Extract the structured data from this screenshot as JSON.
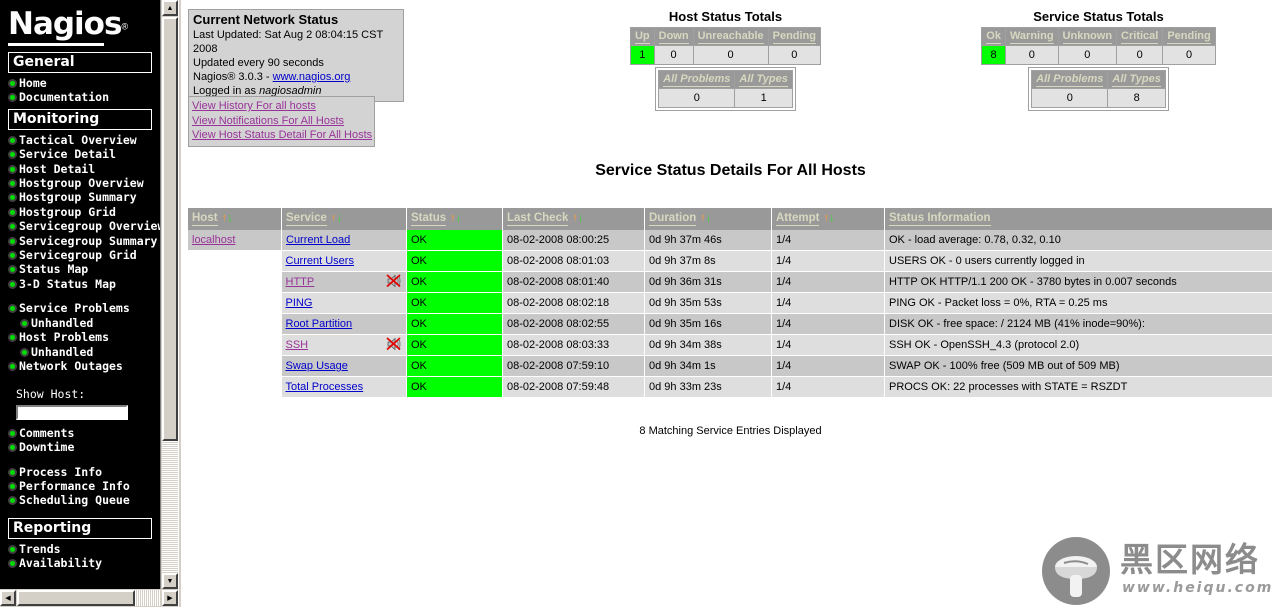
{
  "sidebar": {
    "logo": {
      "text": "Nagios",
      "registered": "®"
    },
    "sections": [
      {
        "title": "General",
        "items": [
          {
            "label": "Home",
            "sub": false
          },
          {
            "label": "Documentation",
            "sub": false
          }
        ]
      },
      {
        "title": "Monitoring",
        "items": [
          {
            "label": "Tactical Overview",
            "sub": false
          },
          {
            "label": "Service Detail",
            "sub": false
          },
          {
            "label": "Host Detail",
            "sub": false
          },
          {
            "label": "Hostgroup Overview",
            "sub": false
          },
          {
            "label": "Hostgroup Summary",
            "sub": false
          },
          {
            "label": "Hostgroup Grid",
            "sub": false
          },
          {
            "label": "Servicegroup Overview",
            "sub": false
          },
          {
            "label": "Servicegroup Summary",
            "sub": false
          },
          {
            "label": "Servicegroup Grid",
            "sub": false
          },
          {
            "label": "Status Map",
            "sub": false
          },
          {
            "label": "3-D Status Map",
            "sub": false
          },
          {
            "label": "",
            "gap": true
          },
          {
            "label": "Service Problems",
            "sub": false
          },
          {
            "label": "Unhandled",
            "sub": true
          },
          {
            "label": "Host Problems",
            "sub": false
          },
          {
            "label": "Unhandled",
            "sub": true
          },
          {
            "label": "Network Outages",
            "sub": false
          }
        ]
      }
    ],
    "show_host": {
      "label": "Show Host:",
      "value": "",
      "placeholder": ""
    },
    "post_items": [
      {
        "label": "Comments",
        "sub": false
      },
      {
        "label": "Downtime",
        "sub": false
      },
      {
        "label": "",
        "gap": true
      },
      {
        "label": "Process Info",
        "sub": false
      },
      {
        "label": "Performance Info",
        "sub": false
      },
      {
        "label": "Scheduling Queue",
        "sub": false
      }
    ],
    "reporting": {
      "title": "Reporting",
      "items": [
        {
          "label": "Trends",
          "sub": false
        },
        {
          "label": "Availability",
          "sub": false
        }
      ]
    },
    "scrollbar": {
      "up_arrow": "▲",
      "down_arrow": "▼",
      "left_arrow": "◀",
      "right_arrow": "▶"
    }
  },
  "network_status": {
    "heading": "Current Network Status",
    "last_updated": "Last Updated: Sat Aug 2 08:04:15 CST 2008",
    "update_interval": "Updated every 90 seconds",
    "version_prefix": "Nagios® 3.0.3 - ",
    "version_link": "www.nagios.org",
    "logged_in_prefix": "Logged in as ",
    "logged_in_user": "nagiosadmin"
  },
  "quick_links": [
    {
      "label": "View History For all hosts"
    },
    {
      "label": "View Notifications For All Hosts"
    },
    {
      "label": "View Host Status Detail For All Hosts"
    }
  ],
  "host_totals": {
    "title": "Host Status Totals",
    "headers": [
      "Up",
      "Down",
      "Unreachable",
      "Pending"
    ],
    "values": [
      "1",
      "0",
      "0",
      "0"
    ],
    "highlight_index": 0,
    "sub_headers": [
      "All Problems",
      "All Types"
    ],
    "sub_values": [
      "0",
      "1"
    ]
  },
  "service_totals": {
    "title": "Service Status Totals",
    "headers": [
      "Ok",
      "Warning",
      "Unknown",
      "Critical",
      "Pending"
    ],
    "values": [
      "8",
      "0",
      "0",
      "0",
      "0"
    ],
    "highlight_index": 0,
    "sub_headers": [
      "All Problems",
      "All Types"
    ],
    "sub_values": [
      "0",
      "8"
    ]
  },
  "page": {
    "heading": "Service Status Details For All Hosts",
    "footer": "8 Matching Service Entries Displayed"
  },
  "table": {
    "columns": [
      {
        "label": "Host",
        "sortable": true
      },
      {
        "label": "Service",
        "sortable": true
      },
      {
        "label": "Status",
        "sortable": true
      },
      {
        "label": "Last Check",
        "sortable": true
      },
      {
        "label": "Duration",
        "sortable": true
      },
      {
        "label": "Attempt",
        "sortable": true
      },
      {
        "label": "Status Information",
        "sortable": false
      }
    ],
    "sort_icons": {
      "up": "↑",
      "down": "↓"
    },
    "rows": [
      {
        "host": "localhost",
        "service": "Current Load",
        "service_visited": false,
        "notifications_disabled": false,
        "status": "OK",
        "last_check": "08-02-2008 08:00:25",
        "duration": "0d 9h 37m 46s",
        "attempt": "1/4",
        "info": "OK - load average: 0.78, 0.32, 0.10"
      },
      {
        "host": "",
        "service": "Current Users",
        "service_visited": false,
        "notifications_disabled": false,
        "status": "OK",
        "last_check": "08-02-2008 08:01:03",
        "duration": "0d 9h 37m 8s",
        "attempt": "1/4",
        "info": "USERS OK - 0 users currently logged in"
      },
      {
        "host": "",
        "service": "HTTP",
        "service_visited": true,
        "notifications_disabled": true,
        "status": "OK",
        "last_check": "08-02-2008 08:01:40",
        "duration": "0d 9h 36m 31s",
        "attempt": "1/4",
        "info": "HTTP OK HTTP/1.1 200 OK - 3780 bytes in 0.007 seconds"
      },
      {
        "host": "",
        "service": "PING",
        "service_visited": false,
        "notifications_disabled": false,
        "status": "OK",
        "last_check": "08-02-2008 08:02:18",
        "duration": "0d 9h 35m 53s",
        "attempt": "1/4",
        "info": "PING OK - Packet loss = 0%, RTA = 0.25 ms"
      },
      {
        "host": "",
        "service": "Root Partition",
        "service_visited": false,
        "notifications_disabled": false,
        "status": "OK",
        "last_check": "08-02-2008 08:02:55",
        "duration": "0d 9h 35m 16s",
        "attempt": "1/4",
        "info": "DISK OK - free space: / 2124 MB (41% inode=90%):"
      },
      {
        "host": "",
        "service": "SSH",
        "service_visited": true,
        "notifications_disabled": true,
        "status": "OK",
        "last_check": "08-02-2008 08:03:33",
        "duration": "0d 9h 34m 38s",
        "attempt": "1/4",
        "info": "SSH OK - OpenSSH_4.3 (protocol 2.0)"
      },
      {
        "host": "",
        "service": "Swap Usage",
        "service_visited": false,
        "notifications_disabled": false,
        "status": "OK",
        "last_check": "08-02-2008 07:59:10",
        "duration": "0d 9h 34m 1s",
        "attempt": "1/4",
        "info": "SWAP OK - 100% free (509 MB out of 509 MB)"
      },
      {
        "host": "",
        "service": "Total Processes",
        "service_visited": false,
        "notifications_disabled": false,
        "status": "OK",
        "last_check": "08-02-2008 07:59:48",
        "duration": "0d 9h 33m 23s",
        "attempt": "1/4",
        "info": "PROCS OK: 22 processes with STATE = RSZDT"
      }
    ]
  },
  "watermark": {
    "chinese": "黑区网络",
    "url": "www.heiqu.com"
  },
  "colors": {
    "ok_green": "#00ff00",
    "header_gray": "#999999",
    "header_text": "#d8d8c0",
    "row_odd": "#c8c8c8",
    "row_even": "#dedede",
    "link_blue": "#0000cc",
    "link_visited": "#993399",
    "sort_up": "#ff9933",
    "sort_down": "#33dd33",
    "sidebar_bg": "#000000",
    "sidebar_text": "#ffffff",
    "bullet_green": "#00dd00"
  }
}
